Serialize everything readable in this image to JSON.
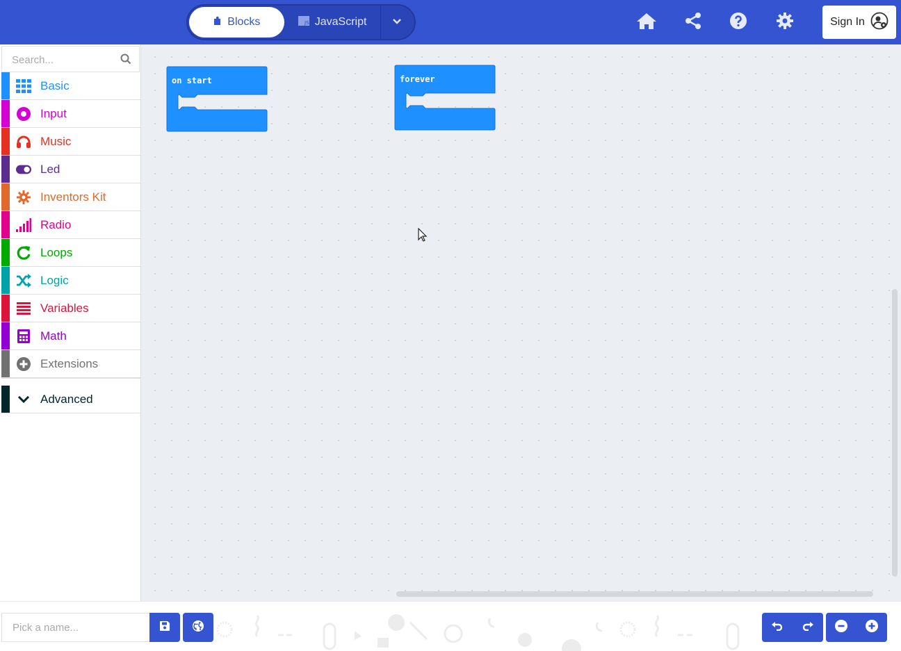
{
  "header": {
    "blocks_label": "Blocks",
    "javascript_label": "JavaScript",
    "signin_label": "Sign In",
    "colors": {
      "bar": "#3454D1",
      "icon": "#e6ebfb"
    }
  },
  "toolbox": {
    "search_placeholder": "Search...",
    "categories": [
      {
        "label": "Basic",
        "color": "#1E90FF",
        "icon": "grid-icon"
      },
      {
        "label": "Input",
        "color": "#D400D4",
        "icon": "radio-target-icon"
      },
      {
        "label": "Music",
        "color": "#E63022",
        "icon": "headphones-icon"
      },
      {
        "label": "Led",
        "color": "#5C2D91",
        "icon": "toggle-icon"
      },
      {
        "label": "Inventors Kit",
        "color": "#E0692E",
        "icon": "gear-icon"
      },
      {
        "label": "Radio",
        "color": "#E3008C",
        "icon": "signal-bars-icon"
      },
      {
        "label": "Loops",
        "color": "#00AA00",
        "icon": "refresh-icon"
      },
      {
        "label": "Logic",
        "color": "#00A4A6",
        "icon": "shuffle-icon"
      },
      {
        "label": "Variables",
        "color": "#DC143C",
        "icon": "list-icon"
      },
      {
        "label": "Math",
        "color": "#9400D3",
        "icon": "calculator-icon"
      },
      {
        "label": "Extensions",
        "color": "#717171",
        "icon": "plus-circle-icon"
      }
    ],
    "advanced": {
      "label": "Advanced",
      "color": "#00272B"
    }
  },
  "workspace": {
    "blocks": [
      {
        "label": "on start",
        "color": "#1E90FF"
      },
      {
        "label": "forever",
        "color": "#1E90FF"
      }
    ]
  },
  "footer": {
    "name_placeholder": "Pick a name..."
  }
}
